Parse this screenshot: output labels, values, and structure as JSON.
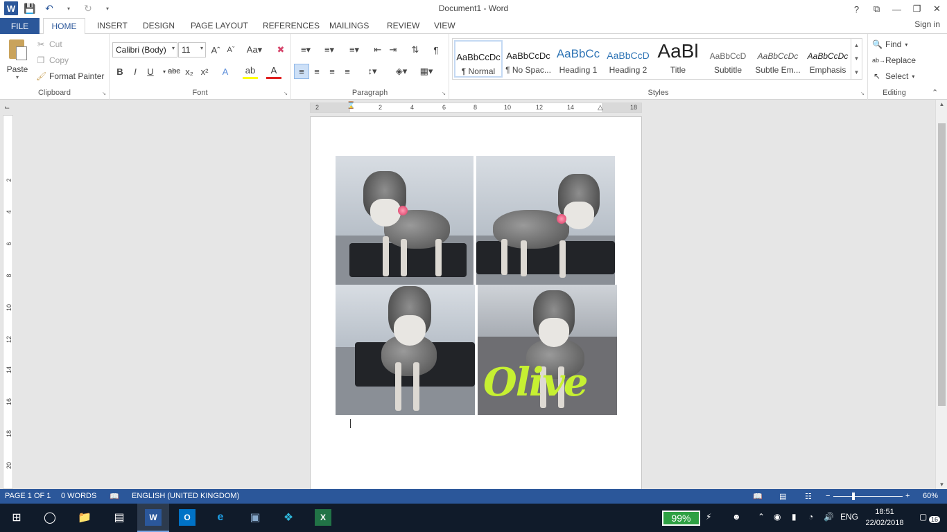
{
  "window": {
    "title": "Document1 - Word",
    "controls": [
      "?",
      "⧉",
      "—",
      "❐",
      "✕"
    ]
  },
  "ribbon_tabs": [
    "FILE",
    "HOME",
    "INSERT",
    "DESIGN",
    "PAGE LAYOUT",
    "REFERENCES",
    "MAILINGS",
    "REVIEW",
    "VIEW"
  ],
  "sign_in": "Sign in",
  "clipboard": {
    "paste": "Paste",
    "cut": "Cut",
    "copy": "Copy",
    "format_painter": "Format Painter",
    "label": "Clipboard"
  },
  "font": {
    "family": "Calibri (Body)",
    "size": "11",
    "label": "Font"
  },
  "paragraph": {
    "label": "Paragraph"
  },
  "styles": {
    "label": "Styles",
    "items": [
      {
        "preview": "AaBbCcDc",
        "name": "¶ Normal"
      },
      {
        "preview": "AaBbCcDc",
        "name": "¶ No Spac..."
      },
      {
        "preview": "AaBbCc",
        "name": "Heading 1"
      },
      {
        "preview": "AaBbCcD",
        "name": "Heading 2"
      },
      {
        "preview": "AaBl",
        "name": "Title"
      },
      {
        "preview": "AaBbCcD",
        "name": "Subtitle"
      },
      {
        "preview": "AaBbCcDc",
        "name": "Subtle Em..."
      },
      {
        "preview": "AaBbCcDc",
        "name": "Emphasis"
      }
    ]
  },
  "editing": {
    "find": "Find",
    "replace": "Replace",
    "select": "Select",
    "label": "Editing"
  },
  "ruler": {
    "h_ticks": [
      "2",
      "2",
      "4",
      "6",
      "8",
      "10",
      "12",
      "14",
      "18"
    ],
    "v_ticks": [
      "2",
      "4",
      "6",
      "8",
      "10",
      "12",
      "14",
      "16",
      "18",
      "20"
    ]
  },
  "document": {
    "photo_caption": "Olive"
  },
  "status": {
    "page": "PAGE 1 OF 1",
    "words": "0 WORDS",
    "language": "ENGLISH (UNITED KINGDOM)",
    "zoom": "60%"
  },
  "taskbar": {
    "battery": "99%",
    "lang": "ENG",
    "time": "18:51",
    "date": "22/02/2018",
    "notifications": "16"
  }
}
